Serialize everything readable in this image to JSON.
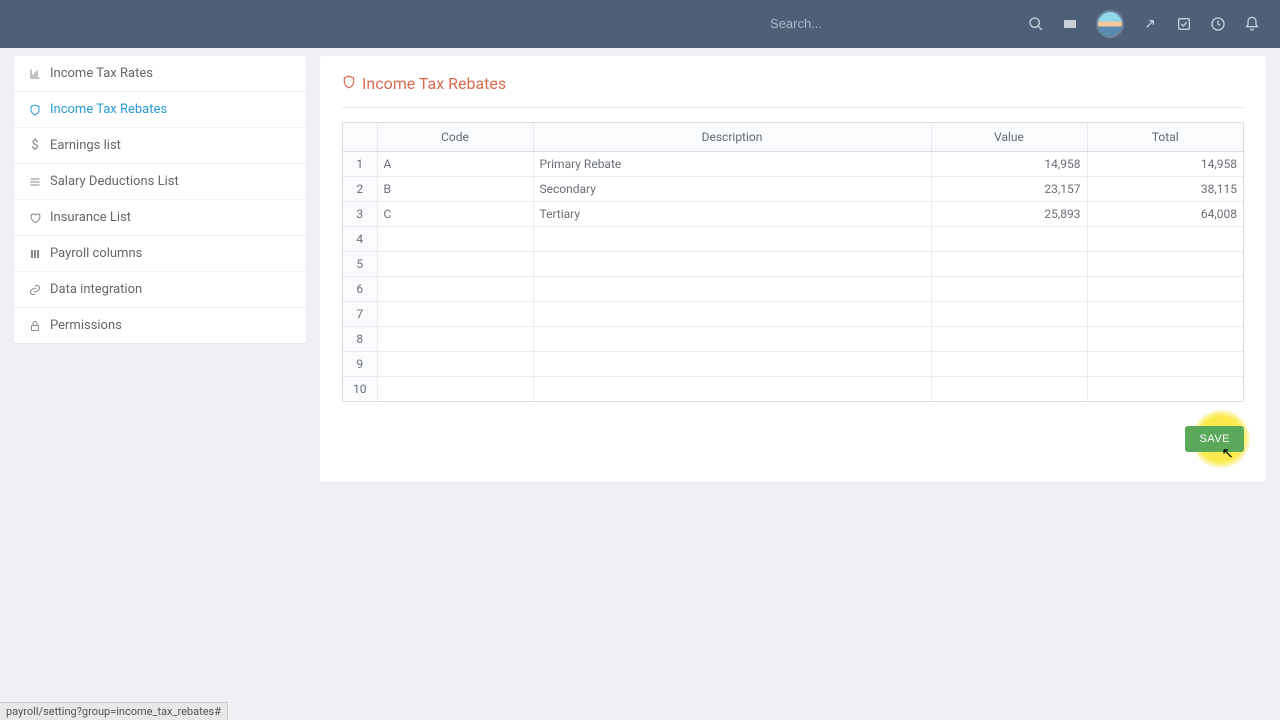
{
  "topbar": {
    "search_placeholder": "Search..."
  },
  "sidebar": {
    "items": [
      {
        "label": "Income Tax Rates",
        "icon": "chart"
      },
      {
        "label": "Income Tax Rebates",
        "icon": "shield",
        "active": true
      },
      {
        "label": "Earnings list",
        "icon": "dollar"
      },
      {
        "label": "Salary Deductions List",
        "icon": "list"
      },
      {
        "label": "Insurance List",
        "icon": "heart"
      },
      {
        "label": "Payroll columns",
        "icon": "columns"
      },
      {
        "label": "Data integration",
        "icon": "link"
      },
      {
        "label": "Permissions",
        "icon": "lock"
      }
    ]
  },
  "page": {
    "title": "Income Tax Rebates",
    "save_label": "SAVE"
  },
  "table": {
    "headers": {
      "code": "Code",
      "description": "Description",
      "value": "Value",
      "total": "Total"
    },
    "rows": [
      {
        "n": "1",
        "code": "A",
        "description": "Primary Rebate",
        "value": "14,958",
        "total": "14,958"
      },
      {
        "n": "2",
        "code": "B",
        "description": "Secondary",
        "value": "23,157",
        "total": "38,115"
      },
      {
        "n": "3",
        "code": "C",
        "description": "Tertiary",
        "value": "25,893",
        "total": "64,008"
      },
      {
        "n": "4",
        "code": "",
        "description": "",
        "value": "",
        "total": ""
      },
      {
        "n": "5",
        "code": "",
        "description": "",
        "value": "",
        "total": ""
      },
      {
        "n": "6",
        "code": "",
        "description": "",
        "value": "",
        "total": ""
      },
      {
        "n": "7",
        "code": "",
        "description": "",
        "value": "",
        "total": ""
      },
      {
        "n": "8",
        "code": "",
        "description": "",
        "value": "",
        "total": ""
      },
      {
        "n": "9",
        "code": "",
        "description": "",
        "value": "",
        "total": ""
      },
      {
        "n": "10",
        "code": "",
        "description": "",
        "value": "",
        "total": ""
      }
    ]
  },
  "status": {
    "text": "payroll/setting?group=income_tax_rebates#"
  }
}
